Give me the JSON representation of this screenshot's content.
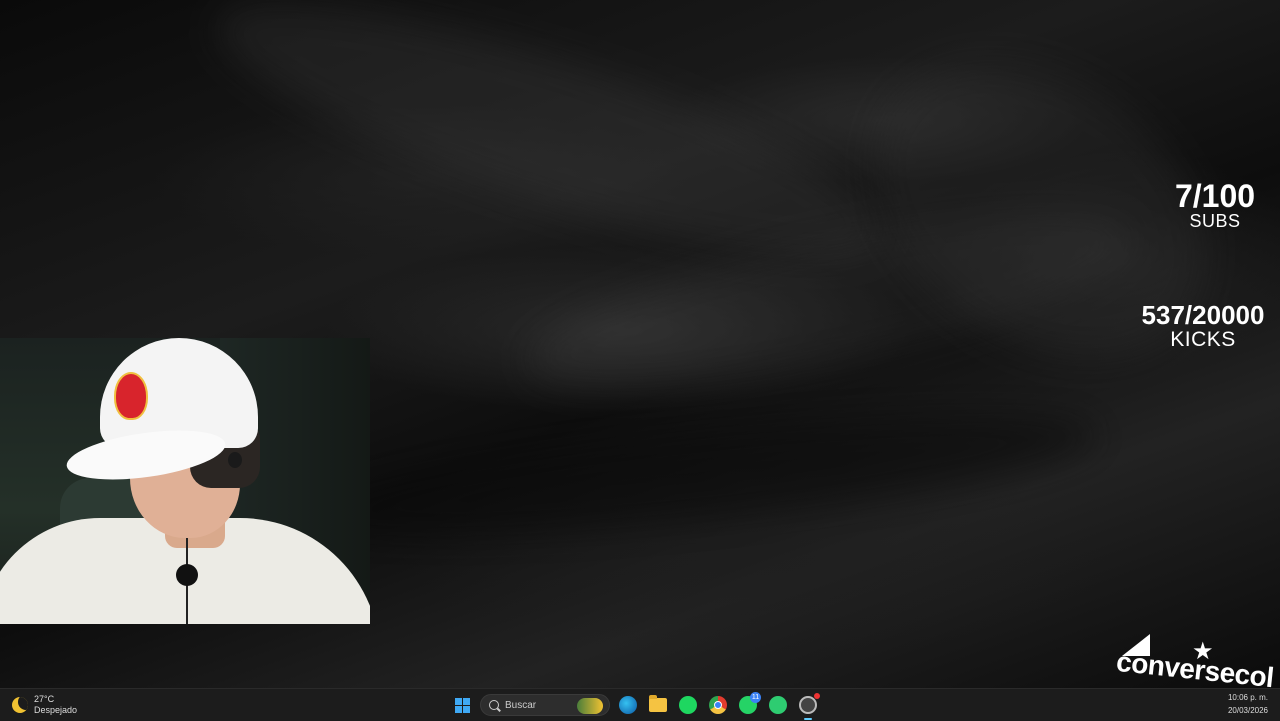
{
  "counters": {
    "subs": {
      "value": "7/100",
      "label": "SUBS"
    },
    "kicks": {
      "value": "537/20000",
      "label": "KICKS"
    }
  },
  "brand": {
    "text": "conversecol"
  },
  "taskbar": {
    "weather": {
      "temp": "27°C",
      "condition": "Despejado",
      "icon": "moon-icon"
    },
    "search": {
      "placeholder": "Buscar"
    },
    "apps": [
      "start-icon",
      "edge-icon",
      "file-explorer-icon",
      "spotify-icon",
      "chrome-icon",
      "whatsapp-icon",
      "app-icon",
      "obs-icon"
    ],
    "whatsapp_badge": "11",
    "clock": {
      "time": "10:06 p. m.",
      "date": "20/03/2026"
    }
  }
}
